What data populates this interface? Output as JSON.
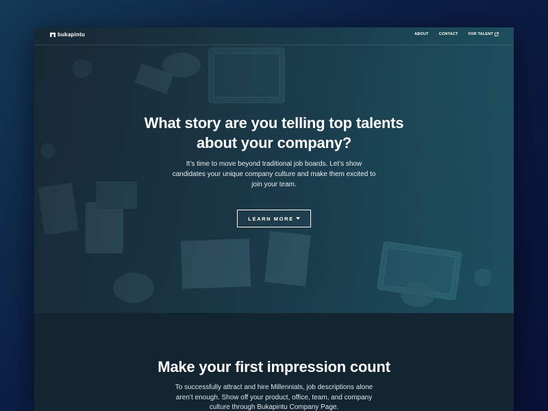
{
  "brand": {
    "name": "bukapintu"
  },
  "nav": {
    "items": [
      {
        "label": "ABOUT"
      },
      {
        "label": "CONTACT"
      },
      {
        "label": "FOR TALENT"
      }
    ]
  },
  "hero": {
    "title": "What story are you telling top talents about your company?",
    "subtitle": "It’s time to move beyond traditional job boards. Let’s show candidates your unique company culture and make them excited to join your team.",
    "cta_label": "LEARN MORE"
  },
  "section2": {
    "title": "Make your first impression count",
    "subtitle": "To successfully attract and hire Millennials, job descriptions alone aren’t enough. Show off your product, office, team, and company culture through Bukapintu Company Page."
  },
  "icons": {
    "logo": "door-icon",
    "external": "external-link-icon",
    "caret": "caret-down-icon"
  },
  "colors": {
    "page_bg": "#0b1e45",
    "hero_tint": "#1f5d70",
    "section_bg": "#132530",
    "text": "#ffffff"
  }
}
